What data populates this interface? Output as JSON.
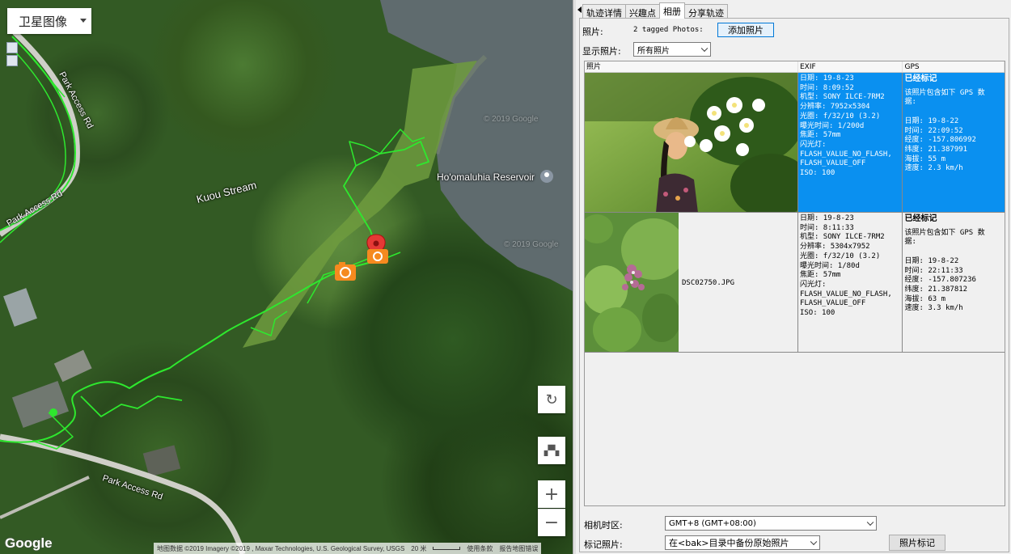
{
  "map": {
    "type_selector": "卫星图像",
    "labels": {
      "park_access_1": "Park Access Rd",
      "park_access_2": "Park Access Rd",
      "park_access_3": "Park Access Rd",
      "kuou_stream": "Kuou Stream",
      "reservoir": "Ho'omaluhia Reservoir",
      "watermark_1": "© 2019 Google",
      "watermark_2": "© 2019 Google"
    },
    "google_logo": "Google",
    "attribution": {
      "data": "地图数据 ©2019 Imagery ©2019 , Maxar Technologies, U.S. Geological Survey, USGS",
      "scale": "20 米",
      "terms": "使用条款",
      "report": "报告地图错误"
    },
    "controls": {
      "zoom_in": "+",
      "zoom_out": "−"
    },
    "track_color": "#2ee82e",
    "marker_color": "#e53935",
    "camera_color": "#f58a1f"
  },
  "panel": {
    "tabs": [
      "轨迹详情",
      "兴趣点",
      "相册",
      "分享轨迹"
    ],
    "active_tab": 2,
    "photos_label": "照片:",
    "photos_count": "2 tagged Photos:",
    "add_photo_button": "添加照片",
    "show_label": "显示照片:",
    "show_value": "所有照片",
    "grid": {
      "headers": [
        "照片",
        "EXIF",
        "GPS"
      ],
      "rows": [
        {
          "filename": "",
          "exif": "日期: 19-8-23\n时间: 8:09:52\n机型: SONY ILCE-7RM2\n分辨率: 7952x5304\n光圈: f/32/10 (3.2)\n曝光时间: 1/200d\n焦距: 57mm\n闪光灯:\nFLASH_VALUE_NO_FLASH,\nFLASH_VALUE_OFF\nISO: 100",
          "gps_status": "已经标记",
          "gps": "该照片包含如下 GPS 数\n据:\n\n日期: 19-8-22\n时间: 22:09:52\n经度: -157.806992\n纬度: 21.387991\n海拔: 55 m\n速度: 2.3 km/h"
        },
        {
          "filename": "DSC02750.JPG",
          "exif": "日期: 19-8-23\n时间: 8:11:33\n机型: SONY ILCE-7RM2\n分辨率: 5304x7952\n光圈: f/32/10 (3.2)\n曝光时间: 1/80d\n焦距: 57mm\n闪光灯:\nFLASH_VALUE_NO_FLASH,\nFLASH_VALUE_OFF\nISO: 100",
          "gps_status": "已经标记",
          "gps": "该照片包含如下 GPS 数\n据:\n\n日期: 19-8-22\n时间: 22:11:33\n经度: -157.807236\n纬度: 21.387812\n海拔: 63 m\n速度: 3.3 km/h"
        }
      ]
    },
    "timezone_label": "相机时区:",
    "timezone_value": "GMT+8 (GMT+08:00)",
    "tag_label": "标记照片:",
    "tag_value": "在<bak>目录中备份原始照片",
    "tag_button": "照片标记",
    "selection_color": "#0a90f0"
  }
}
